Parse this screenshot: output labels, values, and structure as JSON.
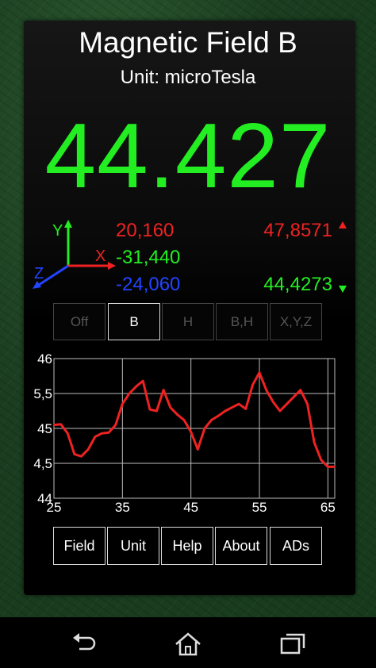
{
  "header": {
    "title": "Magnetic Field B",
    "unit_label": "Unit: microTesla"
  },
  "reading": {
    "value": "44.427"
  },
  "components": {
    "axis_x_label": "X",
    "axis_y_label": "Y",
    "axis_z_label": "Z",
    "x_value": "20,160",
    "y_value": "-31,440",
    "z_value": "-24,060",
    "max_value": "47,8571",
    "min_value": "44,4273"
  },
  "modes": [
    {
      "label": "Off",
      "active": false
    },
    {
      "label": "B",
      "active": true
    },
    {
      "label": "H",
      "active": false
    },
    {
      "label": "B,H",
      "active": false
    },
    {
      "label": "X,Y,Z",
      "active": false
    }
  ],
  "chart_data": {
    "type": "line",
    "x_ticks": [
      "25",
      "35",
      "45",
      "55",
      "65"
    ],
    "y_ticks": [
      "46",
      "5,5",
      "45",
      "4,5",
      "44"
    ],
    "xlim": [
      25,
      66
    ],
    "ylim": [
      44,
      46
    ],
    "grid": true,
    "series": [
      {
        "color": "#ee2222",
        "x": [
          25,
          26,
          27,
          28,
          29,
          30,
          31,
          32,
          33,
          34,
          35,
          36,
          37,
          38,
          39,
          40,
          41,
          42,
          43,
          44,
          45,
          46,
          47,
          48,
          49,
          50,
          51,
          52,
          53,
          54,
          55,
          56,
          57,
          58,
          59,
          60,
          61,
          62,
          63,
          64,
          65,
          66
        ],
        "values": [
          45.05,
          45.06,
          44.93,
          44.63,
          44.6,
          44.7,
          44.88,
          44.93,
          44.94,
          45.05,
          45.35,
          45.5,
          45.6,
          45.68,
          45.27,
          45.25,
          45.55,
          45.3,
          45.2,
          45.12,
          44.95,
          44.7,
          45.0,
          45.12,
          45.18,
          45.25,
          45.3,
          45.35,
          45.28,
          45.62,
          45.8,
          45.55,
          45.38,
          45.25,
          45.35,
          45.45,
          45.55,
          45.35,
          44.8,
          44.55,
          44.45,
          44.45
        ]
      }
    ]
  },
  "toolbar": {
    "field_label": "Field",
    "unit_label": "Unit",
    "help_label": "Help",
    "about_label": "About",
    "ads_label": "ADs"
  },
  "nav": {
    "icons": [
      "back-icon",
      "home-icon",
      "recent-apps-icon"
    ]
  }
}
